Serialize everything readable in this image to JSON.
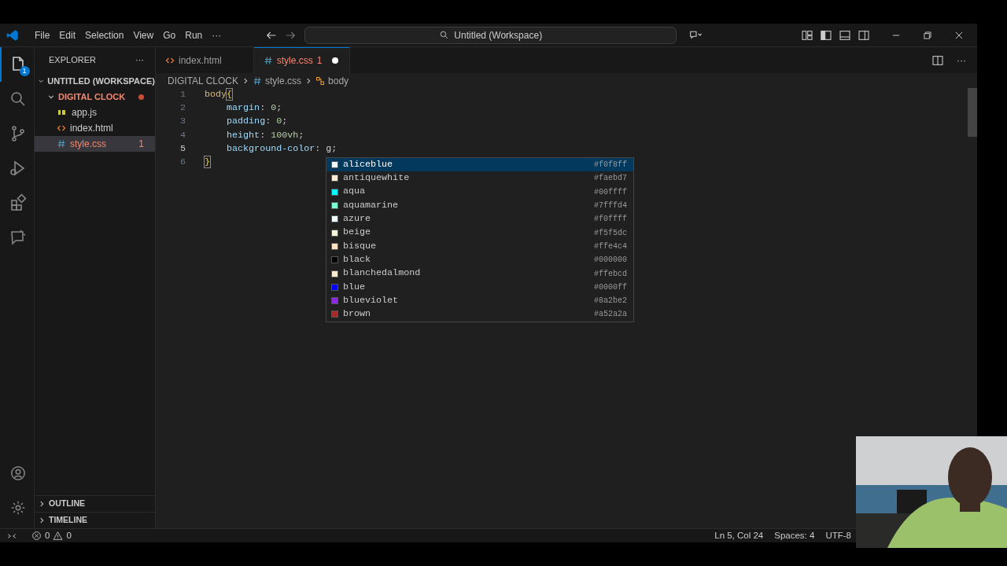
{
  "title_bar": {
    "menus": [
      "File",
      "Edit",
      "Selection",
      "View",
      "Go",
      "Run",
      "···"
    ],
    "search": "Untitled (Workspace)"
  },
  "activity_bar": [
    {
      "kind": "explorer",
      "selected": true,
      "badge": "1"
    },
    {
      "kind": "search",
      "selected": false
    },
    {
      "kind": "source-control",
      "selected": false
    },
    {
      "kind": "run",
      "selected": false
    },
    {
      "kind": "extensions",
      "selected": false
    },
    {
      "kind": "remote",
      "selected": false
    }
  ],
  "activity_bar_bottom": [
    {
      "kind": "account"
    },
    {
      "kind": "settings"
    }
  ],
  "sidebar": {
    "title": "EXPLORER",
    "more": "···",
    "tree": [
      {
        "label": "UNTITLED (WORKSPACE)",
        "kind": "root",
        "expanded": true,
        "children": [
          {
            "label": "DIGITAL CLOCK",
            "kind": "folder",
            "expanded": true,
            "modified": true,
            "error": true,
            "children": [
              {
                "label": "app.js",
                "kind": "js",
                "selected": false,
                "error": false
              },
              {
                "label": "index.html",
                "kind": "html",
                "selected": false,
                "error": false
              },
              {
                "label": "style.css",
                "kind": "css",
                "selected": true,
                "error": true,
                "badge": "1"
              }
            ]
          }
        ]
      }
    ],
    "panels": [
      {
        "label": "OUTLINE",
        "expanded": false
      },
      {
        "label": "TIMELINE",
        "expanded": false
      }
    ]
  },
  "editor_actions": {
    "more": "···"
  },
  "tabs": [
    {
      "label": "index.html",
      "kind": "html",
      "selected": false,
      "error": false
    },
    {
      "label": "style.css",
      "kind": "css",
      "selected": true,
      "error": true,
      "badge": "1",
      "modified": true
    }
  ],
  "breadcrumbs": [
    {
      "label": "DIGITAL CLOCK",
      "kind": "folder"
    },
    {
      "label": "style.css",
      "kind": "css"
    },
    {
      "label": "body",
      "kind": "symbol"
    }
  ],
  "code": [
    {
      "number": "1",
      "current": false,
      "tokens": [
        {
          "kind": "selector",
          "text": "body"
        },
        {
          "kind": "brace",
          "text": "{"
        }
      ]
    },
    {
      "number": "2",
      "current": false,
      "indented": true,
      "tokens": [
        {
          "kind": "property",
          "text": "margin"
        },
        {
          "kind": "punct",
          "text": ": "
        },
        {
          "kind": "number",
          "text": "0"
        },
        {
          "kind": "punct",
          "text": ";"
        }
      ]
    },
    {
      "number": "3",
      "current": false,
      "indented": true,
      "tokens": [
        {
          "kind": "property",
          "text": "padding"
        },
        {
          "kind": "punct",
          "text": ": "
        },
        {
          "kind": "number",
          "text": "0"
        },
        {
          "kind": "punct",
          "text": ";"
        }
      ]
    },
    {
      "number": "4",
      "current": false,
      "indented": true,
      "tokens": [
        {
          "kind": "property",
          "text": "height"
        },
        {
          "kind": "punct",
          "text": ": "
        },
        {
          "kind": "number",
          "text": "100vh"
        },
        {
          "kind": "punct",
          "text": ";"
        }
      ]
    },
    {
      "number": "5",
      "current": true,
      "indented": true,
      "tokens": [
        {
          "kind": "property",
          "text": "background-color"
        },
        {
          "kind": "punct",
          "text": ": "
        },
        {
          "kind": "plain",
          "text": "g"
        },
        {
          "kind": "punct",
          "text": ";"
        }
      ]
    },
    {
      "number": "6",
      "current": false,
      "tokens": [
        {
          "kind": "brace",
          "text": "}"
        }
      ]
    }
  ],
  "suggestions": [
    {
      "name": "aliceblue",
      "hex": "#f0f8ff",
      "color": "#f0f8ff",
      "selected": true
    },
    {
      "name": "antiquewhite",
      "hex": "#faebd7",
      "color": "#faebd7",
      "selected": false
    },
    {
      "name": "aqua",
      "hex": "#00ffff",
      "color": "#00ffff",
      "selected": false
    },
    {
      "name": "aquamarine",
      "hex": "#7fffd4",
      "color": "#7fffd4",
      "selected": false
    },
    {
      "name": "azure",
      "hex": "#f0ffff",
      "color": "#f0ffff",
      "selected": false
    },
    {
      "name": "beige",
      "hex": "#f5f5dc",
      "color": "#f5f5dc",
      "selected": false
    },
    {
      "name": "bisque",
      "hex": "#ffe4c4",
      "color": "#ffe4c4",
      "selected": false
    },
    {
      "name": "black",
      "hex": "#000000",
      "color": "#000000",
      "selected": false
    },
    {
      "name": "blanchedalmond",
      "hex": "#ffebcd",
      "color": "#ffebcd",
      "selected": false
    },
    {
      "name": "blue",
      "hex": "#0000ff",
      "color": "#0000ff",
      "selected": false
    },
    {
      "name": "blueviolet",
      "hex": "#8a2be2",
      "color": "#8a2be2",
      "selected": false
    },
    {
      "name": "brown",
      "hex": "#a52a2a",
      "color": "#a52a2a",
      "selected": false
    }
  ],
  "status_bar": {
    "errors": "0",
    "warnings": "0",
    "right": [
      "Ln 5, Col 24",
      "Spaces: 4",
      "UTF-8"
    ]
  }
}
